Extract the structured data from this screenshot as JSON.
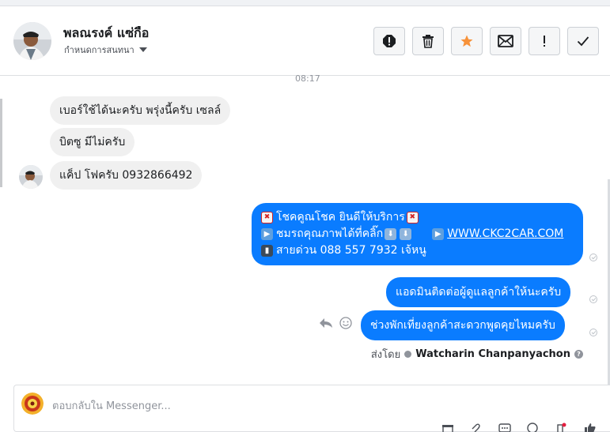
{
  "header": {
    "name": "พลณรงค์ แซ่กือ",
    "assign_label": "กำหนดการสนทนา"
  },
  "toolbar": {
    "buttons": [
      "spam",
      "delete",
      "star",
      "mark-unread",
      "follow-up",
      "done"
    ]
  },
  "chat": {
    "timestamp": "08:17",
    "incoming": [
      "เบอร์ใช้ได้นะครับ พรุ่งนี้ครับ เซลล์",
      "บิตซู มีไม่ครับ",
      "แค็ป โฟครับ 0932866492"
    ],
    "outgoing_promo": {
      "line1": "โชคคูณโชค ยินดีให้บริการ",
      "line2": "ชมรถคุณภาพได้ที่คลิ๊ก",
      "link": "WWW.CKC2CAR.COM",
      "line3": "สายด่วน 088 557 7932 เจ้หนู"
    },
    "outgoing": [
      "แอดมินติดต่อผู้ดูแลลูกค้าให้นะครับ",
      "ช่วงพักเที่ยงลูกค้าสะดวกพูดคุยไหมครับ"
    ],
    "sent_by_label": "ส่งโดย",
    "sent_by_name": "Watcharin Chanpanyachon"
  },
  "composer": {
    "placeholder": "ตอบกลับใน Messenger..."
  },
  "colors": {
    "outgoing_bubble": "#0a7cff",
    "incoming_bubble": "#f0f0f0",
    "star": "#f7923a"
  }
}
